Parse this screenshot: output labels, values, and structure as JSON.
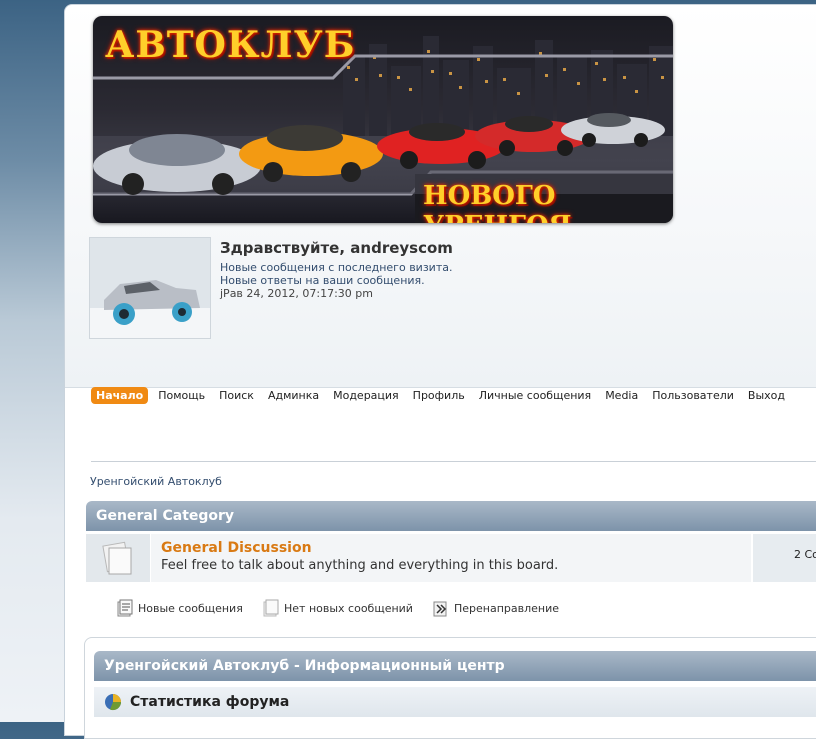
{
  "banner": {
    "title_line1": "АВТОКЛУБ",
    "title_line2": "НОВОГО УРЕНГОЯ"
  },
  "user": {
    "greeting": "Здравствуйте, andreyscom",
    "new_posts": "Новые сообщения с последнего визита.",
    "new_replies": "Новые ответы на ваши сообщения.",
    "datetime": "jРав 24, 2012, 07:17:30 pm"
  },
  "nav": {
    "items": [
      "Начало",
      "Помощь",
      "Поиск",
      "Админка",
      "Модерация",
      "Профиль",
      "Личные сообщения",
      "Media",
      "Пользователи",
      "Выход"
    ],
    "active_index": 0
  },
  "breadcrumb": "Уренгойский Автоклуб",
  "category": {
    "title": "General Category",
    "board": {
      "name": "General Discussion",
      "description": "Feel free to talk about anything and everything in this board.",
      "stats": "2 Со"
    }
  },
  "legend": {
    "new": "Новые сообщения",
    "no_new": "Нет новых сообщений",
    "redirect": "Перенаправление"
  },
  "info_center": {
    "title": "Уренгойский Автоклуб - Информационный центр",
    "stats_title": "Статистика форума"
  },
  "colors": {
    "accent": "#f08a13",
    "board_link": "#d97a14",
    "header_bar": "#8aa0b6"
  }
}
